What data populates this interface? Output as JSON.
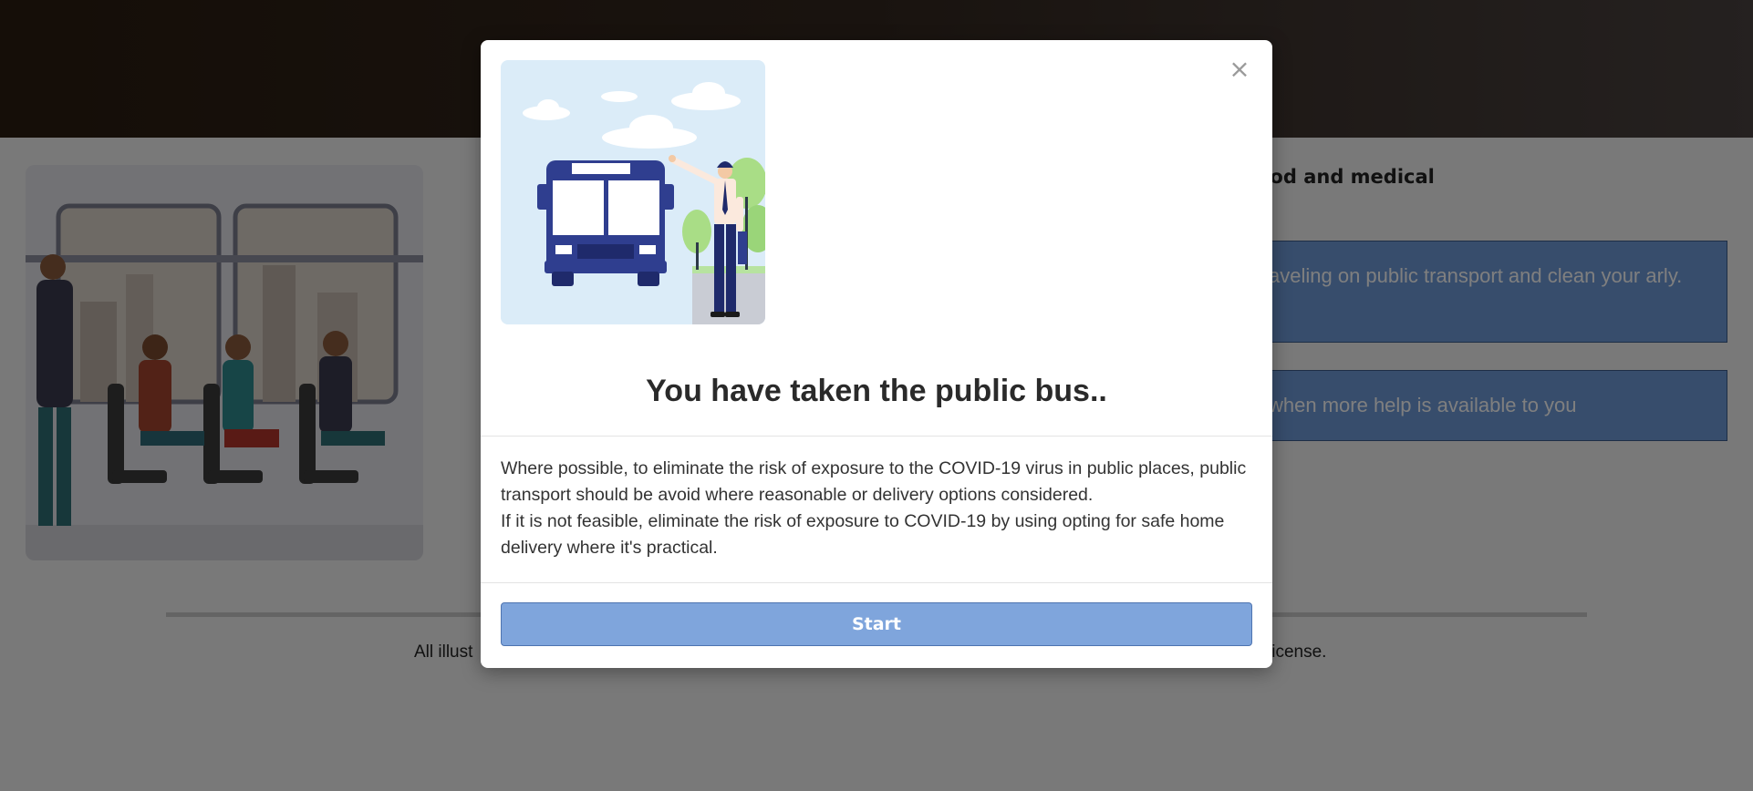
{
  "background": {
    "side_heading": "ood and medical",
    "cards": [
      {
        "text": "aveling on public transport and clean your arly."
      },
      {
        "text": " when more help is available to you"
      }
    ],
    "footer_left": "All illust",
    "footer_right": "license."
  },
  "modal": {
    "close_label": "×",
    "title": "You have taken the public bus..",
    "body_paragraphs": [
      "Where possible, to eliminate the risk of exposure to the COVID-19 virus in public places, public transport should be avoid where reasonable or delivery options considered.",
      "If it is not feasible, eliminate the risk of exposure to COVID-19 by using opting for safe home delivery where it's practical."
    ],
    "start_label": "Start"
  },
  "colors": {
    "button_bg": "#7fa5dc",
    "card_bg": "#6f9ad9",
    "topbar": "#2a1c10",
    "bus_blue": "#2f3e8f"
  },
  "icons": [
    "close-icon",
    "bus-illustration",
    "passengers-illustration"
  ]
}
